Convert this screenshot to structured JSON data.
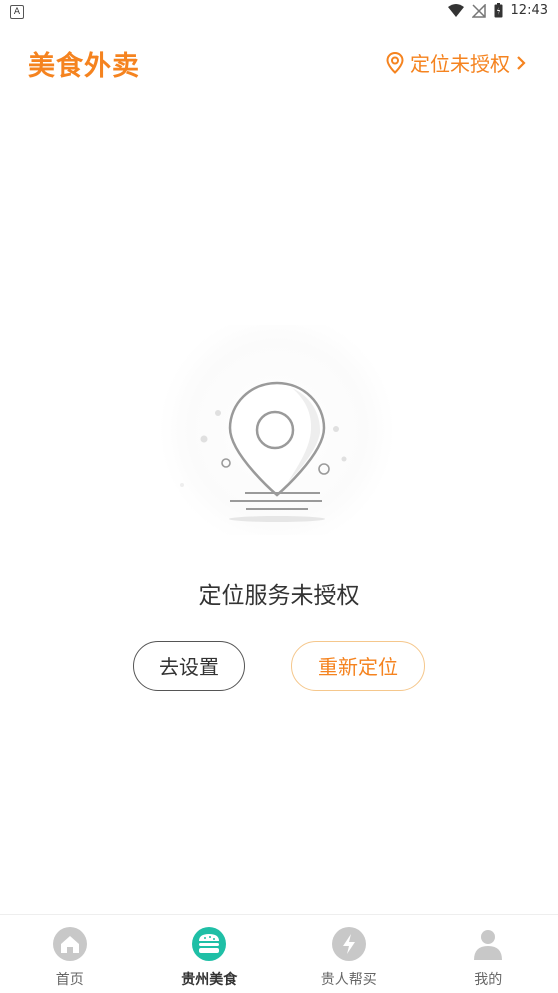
{
  "status_bar": {
    "time": "12:43",
    "notification_letter": "A"
  },
  "header": {
    "title": "美食外卖",
    "location_label": "定位未授权"
  },
  "empty_state": {
    "title": "定位服务未授权"
  },
  "buttons": {
    "settings": "去设置",
    "relocate": "重新定位"
  },
  "tabs": [
    {
      "label": "首页",
      "icon": "home-icon"
    },
    {
      "label": "贵州美食",
      "icon": "burger-icon"
    },
    {
      "label": "贵人帮买",
      "icon": "lightning-icon"
    },
    {
      "label": "我的",
      "icon": "person-icon"
    }
  ],
  "colors": {
    "accent": "#f5831f",
    "tab_active": "#1fbfa6",
    "tab_inactive": "#c8c8c8"
  }
}
